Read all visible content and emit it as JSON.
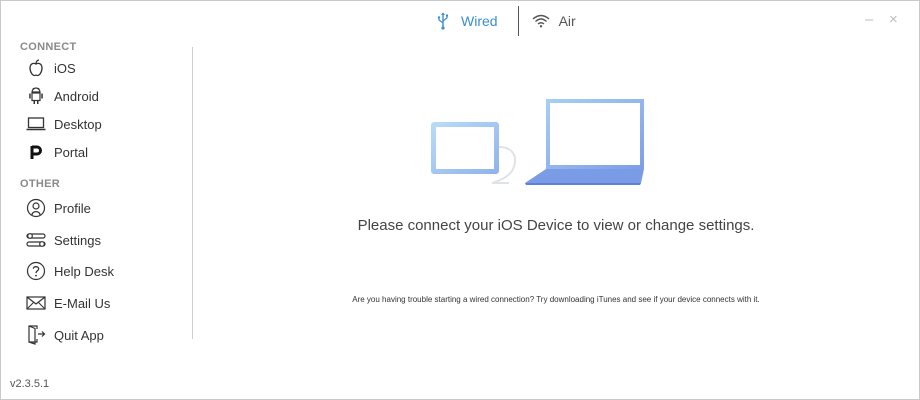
{
  "tabs": {
    "wired": {
      "label": "Wired",
      "icon": "usb-icon",
      "active": true,
      "color": "#3a8fd1"
    },
    "air": {
      "label": "Air",
      "icon": "wifi-icon"
    }
  },
  "window_controls": {
    "minimize": "–",
    "close": "×"
  },
  "sidebar": {
    "connect_label": "CONNECT",
    "connect_items": [
      {
        "label": "iOS",
        "icon": "apple-icon"
      },
      {
        "label": "Android",
        "icon": "android-icon"
      },
      {
        "label": "Desktop",
        "icon": "laptop-icon"
      },
      {
        "label": "Portal",
        "icon": "portal-icon"
      }
    ],
    "other_label": "OTHER",
    "other_items": [
      {
        "label": "Profile",
        "icon": "profile-icon"
      },
      {
        "label": "Settings",
        "icon": "settings-icon"
      },
      {
        "label": "Help Desk",
        "icon": "help-icon"
      },
      {
        "label": "E-Mail Us",
        "icon": "mail-icon"
      },
      {
        "label": "Quit App",
        "icon": "quit-icon"
      }
    ]
  },
  "main": {
    "message": "Please connect your iOS Device to view or change settings.",
    "hint": "Are you having trouble starting a wired connection?  Try downloading iTunes and see if your device connects with it."
  },
  "version": "v2.3.5.1"
}
